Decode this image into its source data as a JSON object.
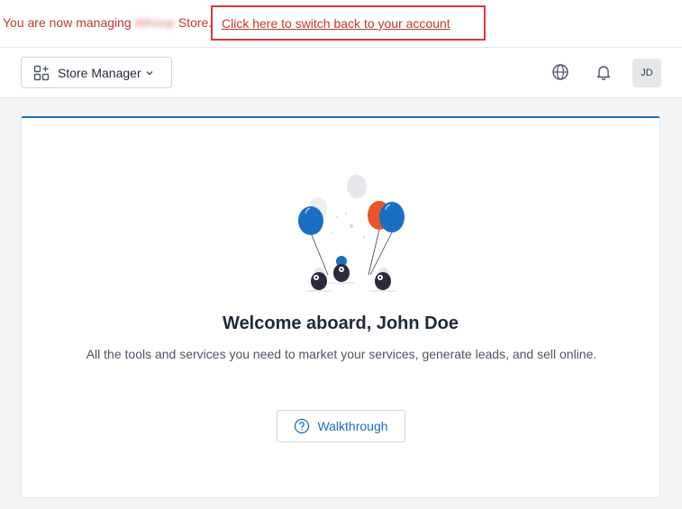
{
  "banner": {
    "prefix": "You are now managing",
    "store_name_redacted": "Whoop",
    "suffix": "Store.",
    "switch_link": "Click here to switch back to your account"
  },
  "topbar": {
    "store_manager_label": "Store Manager",
    "avatar_initials": "JD",
    "icons": [
      "apps-icon",
      "chevron-down-icon",
      "globe-icon",
      "bell-icon"
    ]
  },
  "card": {
    "title": "Welcome aboard, John Doe",
    "description": "All the tools and services you need to market your services, generate leads, and sell online.",
    "walkthrough_label": "Walkthrough"
  },
  "colors": {
    "banner_text": "#c0392b",
    "highlight_box": "#d9373a",
    "accent": "#1a6fc2",
    "balloon_orange": "#e8562a"
  }
}
